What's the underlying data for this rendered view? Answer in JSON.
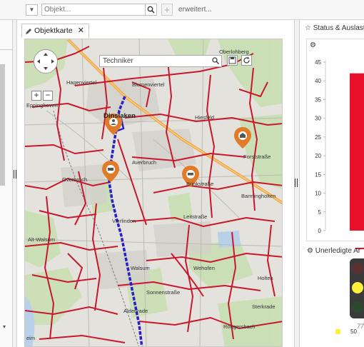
{
  "toolbar": {
    "search_placeholder": "Objekt...",
    "add_label": "+",
    "advanced_label": "erweitert..."
  },
  "map_tab": {
    "label": "Objektkarte",
    "close": "✕"
  },
  "map": {
    "search_value": "Techniker",
    "zoom_in": "+",
    "zoom_out": "−",
    "places": {
      "oberlohberg": "Oberlohberg",
      "hagenviertel": "Hagenviertel",
      "blumenviertel": "Blumenviertel",
      "eppinghoven": "Eppinghoven",
      "dinslaken": "Dinslaken",
      "hiesfeld": "Hiesfeld",
      "averbruch": "Averbruch",
      "overbruch": "Overbruch",
      "brinkstrasse": "Brinkstraße",
      "barmingholten": "Barmingholten",
      "alt_walsum": "Alt-Walsum",
      "vierlinden": "Vierlinden",
      "walsum": "Walsum",
      "wehofen": "Wehofen",
      "holten": "Holten",
      "aldenrade": "Aldenrade",
      "roettgersbach": "Röttgersbach",
      "sterkrade": "Sterkrade",
      "leim": "eim",
      "forststrasse": "Forststraße",
      "leitstrasse": "Leitstraße",
      "sonnenstrasse": "Sonnenstraße"
    }
  },
  "status_panel": {
    "title": "Status & Auslastung",
    "y_ticks": [
      "0",
      "5",
      "10",
      "15",
      "20",
      "25",
      "30",
      "35",
      "40",
      "45"
    ]
  },
  "open_panel": {
    "title": "Unerledigte Ar",
    "partial_value": "77",
    "legend_value": "50"
  },
  "chart_data": {
    "type": "bar",
    "ylim": [
      0,
      45
    ],
    "y_ticks": [
      0,
      5,
      10,
      15,
      20,
      25,
      30,
      35,
      40,
      45
    ],
    "series": [
      {
        "values": [
          42
        ],
        "color": "#e8102a"
      }
    ]
  },
  "colors": {
    "road": "#c8182e",
    "route": "#2b1fc8",
    "marker": "#e07b28",
    "bar": "#e8102a",
    "light_yellow": "#ffef3a"
  }
}
